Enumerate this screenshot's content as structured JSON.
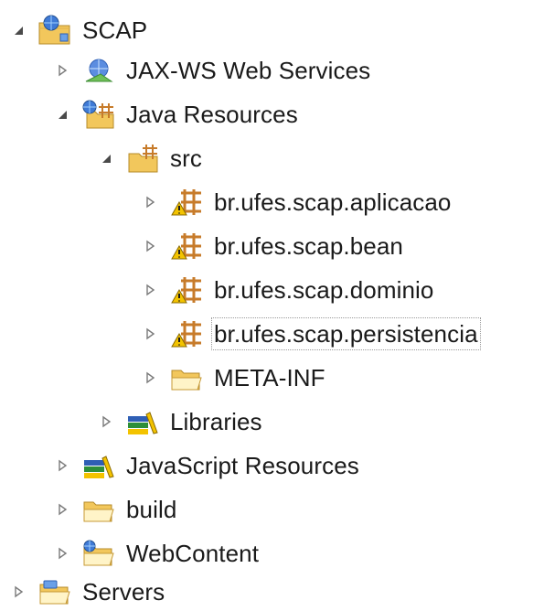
{
  "tree": {
    "items": [
      {
        "label": "SCAP",
        "icon": "web-project-icon",
        "expanded": true
      },
      {
        "label": "JAX-WS Web Services",
        "icon": "web-services-icon",
        "expanded": false
      },
      {
        "label": "Java Resources",
        "icon": "java-resources-icon",
        "expanded": true
      },
      {
        "label": "src",
        "icon": "source-folder-icon",
        "expanded": true
      },
      {
        "label": "br.ufes.scap.aplicacao",
        "icon": "package-warning-icon",
        "expanded": false
      },
      {
        "label": "br.ufes.scap.bean",
        "icon": "package-warning-icon",
        "expanded": false
      },
      {
        "label": "br.ufes.scap.dominio",
        "icon": "package-warning-icon",
        "expanded": false
      },
      {
        "label": "br.ufes.scap.persistencia",
        "icon": "package-warning-icon",
        "expanded": false,
        "selected": true
      },
      {
        "label": "META-INF",
        "icon": "folder-icon",
        "expanded": false
      },
      {
        "label": "Libraries",
        "icon": "libraries-icon",
        "expanded": false
      },
      {
        "label": "JavaScript Resources",
        "icon": "libraries-icon",
        "expanded": false
      },
      {
        "label": "build",
        "icon": "folder-icon",
        "expanded": false
      },
      {
        "label": "WebContent",
        "icon": "web-folder-icon",
        "expanded": false
      },
      {
        "label": "Servers",
        "icon": "servers-folder-icon",
        "expanded": false
      }
    ]
  },
  "colors": {
    "folder": "#f2c75c",
    "package": "#c77b2a",
    "warning": "#f3c300",
    "arrow": "#7a7a7a",
    "books_green": "#2d8f3a",
    "books_blue": "#2f5fb5"
  }
}
